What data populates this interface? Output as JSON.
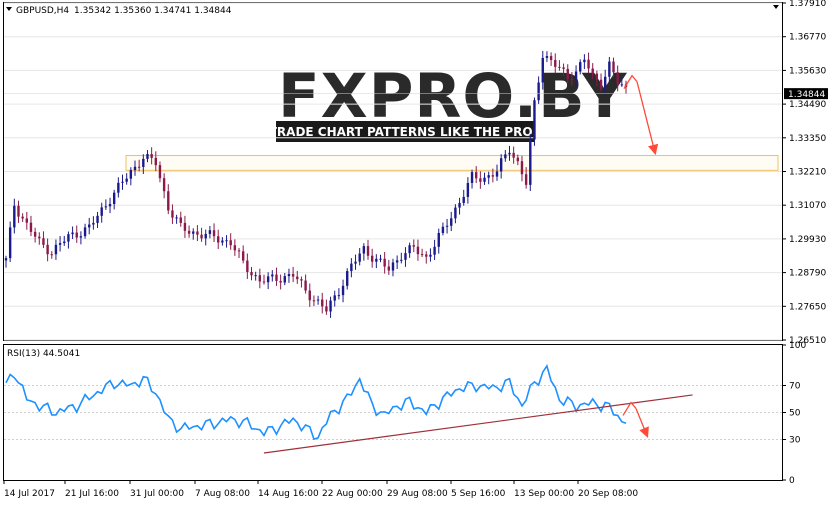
{
  "header": {
    "symbol": "GBPUSD,H4",
    "ohlc": "1.35342 1.35360 1.34741 1.34844"
  },
  "watermark": {
    "logo": "FXPRO.BY",
    "tagline": "TRADE CHART PATTERNS LIKE THE PROS"
  },
  "price_panel": {
    "y_ticks": [
      "1.37910",
      "1.36770",
      "1.35630",
      "1.34490",
      "1.33350",
      "1.32210",
      "1.31070",
      "1.29930",
      "1.28790",
      "1.27650",
      "1.26510"
    ],
    "last_price_label": "1.34844"
  },
  "rsi_panel": {
    "label": "RSI(13) 44.5041",
    "y_ticks": [
      "100",
      "70",
      "50",
      "30",
      "0"
    ]
  },
  "x_axis": {
    "labels": [
      "14 Jul 2017",
      "21 Jul 16:00",
      "31 Jul 00:00",
      "7 Aug 08:00",
      "14 Aug 16:00",
      "22 Aug 00:00",
      "29 Aug 08:00",
      "5 Sep 16:00",
      "13 Sep 00:00",
      "20 Sep 08:00"
    ]
  },
  "colors": {
    "bull": "#1a1a8c",
    "bear": "#8b1a4a",
    "rsi_line": "#1e90ff",
    "trendline": "#a0303a",
    "arrow": "#ff4a3a",
    "zone_border": "#f0c060",
    "grid": "#e6e6e6"
  },
  "chart_data": [
    {
      "type": "candlestick",
      "symbol": "GBPUSD",
      "timeframe": "H4",
      "ylim": [
        1.2651,
        1.3791
      ],
      "last": 1.34844,
      "path": [
        [
          0,
          1.292
        ],
        [
          2,
          1.311
        ],
        [
          5,
          1.304
        ],
        [
          8,
          1.298
        ],
        [
          11,
          1.295
        ],
        [
          15,
          1.3
        ],
        [
          20,
          1.303
        ],
        [
          25,
          1.313
        ],
        [
          30,
          1.322
        ],
        [
          33,
          1.327
        ],
        [
          36,
          1.325
        ],
        [
          39,
          1.31
        ],
        [
          42,
          1.303
        ],
        [
          46,
          1.301
        ],
        [
          50,
          1.3
        ],
        [
          54,
          1.298
        ],
        [
          57,
          1.291
        ],
        [
          61,
          1.285
        ],
        [
          65,
          1.286
        ],
        [
          69,
          1.287
        ],
        [
          72,
          1.282
        ],
        [
          74,
          1.279
        ],
        [
          77,
          1.275
        ],
        [
          80,
          1.282
        ],
        [
          83,
          1.29
        ],
        [
          86,
          1.296
        ],
        [
          89,
          1.292
        ],
        [
          92,
          1.289
        ],
        [
          95,
          1.294
        ],
        [
          98,
          1.296
        ],
        [
          101,
          1.293
        ],
        [
          105,
          1.302
        ],
        [
          109,
          1.312
        ],
        [
          112,
          1.32
        ],
        [
          115,
          1.32
        ],
        [
          118,
          1.322
        ],
        [
          121,
          1.33
        ],
        [
          123,
          1.325
        ],
        [
          125,
          1.318
        ],
        [
          127,
          1.345
        ],
        [
          129,
          1.362
        ],
        [
          132,
          1.358
        ],
        [
          135,
          1.354
        ],
        [
          137,
          1.356
        ],
        [
          139,
          1.36
        ],
        [
          141,
          1.354
        ],
        [
          143,
          1.352
        ],
        [
          145,
          1.358
        ],
        [
          147,
          1.352
        ],
        [
          149,
          1.35
        ]
      ],
      "zone": [
        1.3225,
        1.3275
      ],
      "forecast_arrows": [
        [
          1.3525,
          1.3285
        ]
      ]
    },
    {
      "type": "line",
      "name": "RSI(13)",
      "last": 44.5041,
      "ylim": [
        0,
        100
      ],
      "levels": [
        70,
        50,
        30
      ],
      "path": [
        [
          0,
          70
        ],
        [
          2,
          80
        ],
        [
          5,
          60
        ],
        [
          8,
          55
        ],
        [
          12,
          50
        ],
        [
          17,
          55
        ],
        [
          22,
          65
        ],
        [
          26,
          72
        ],
        [
          30,
          70
        ],
        [
          33,
          75
        ],
        [
          36,
          65
        ],
        [
          39,
          45
        ],
        [
          42,
          38
        ],
        [
          46,
          40
        ],
        [
          50,
          42
        ],
        [
          54,
          45
        ],
        [
          58,
          42
        ],
        [
          62,
          35
        ],
        [
          66,
          40
        ],
        [
          69,
          45
        ],
        [
          72,
          38
        ],
        [
          75,
          32
        ],
        [
          78,
          48
        ],
        [
          82,
          60
        ],
        [
          85,
          75
        ],
        [
          88,
          55
        ],
        [
          91,
          48
        ],
        [
          94,
          55
        ],
        [
          97,
          58
        ],
        [
          101,
          50
        ],
        [
          105,
          60
        ],
        [
          109,
          68
        ],
        [
          113,
          70
        ],
        [
          117,
          68
        ],
        [
          121,
          72
        ],
        [
          124,
          55
        ],
        [
          127,
          72
        ],
        [
          130,
          82
        ],
        [
          133,
          60
        ],
        [
          137,
          55
        ],
        [
          141,
          57
        ],
        [
          145,
          54
        ],
        [
          148,
          44
        ]
      ],
      "trendline": [
        [
          62,
          20
        ],
        [
          165,
          63
        ]
      ],
      "forecast_arrows": [
        [
          53,
          33
        ]
      ]
    }
  ]
}
